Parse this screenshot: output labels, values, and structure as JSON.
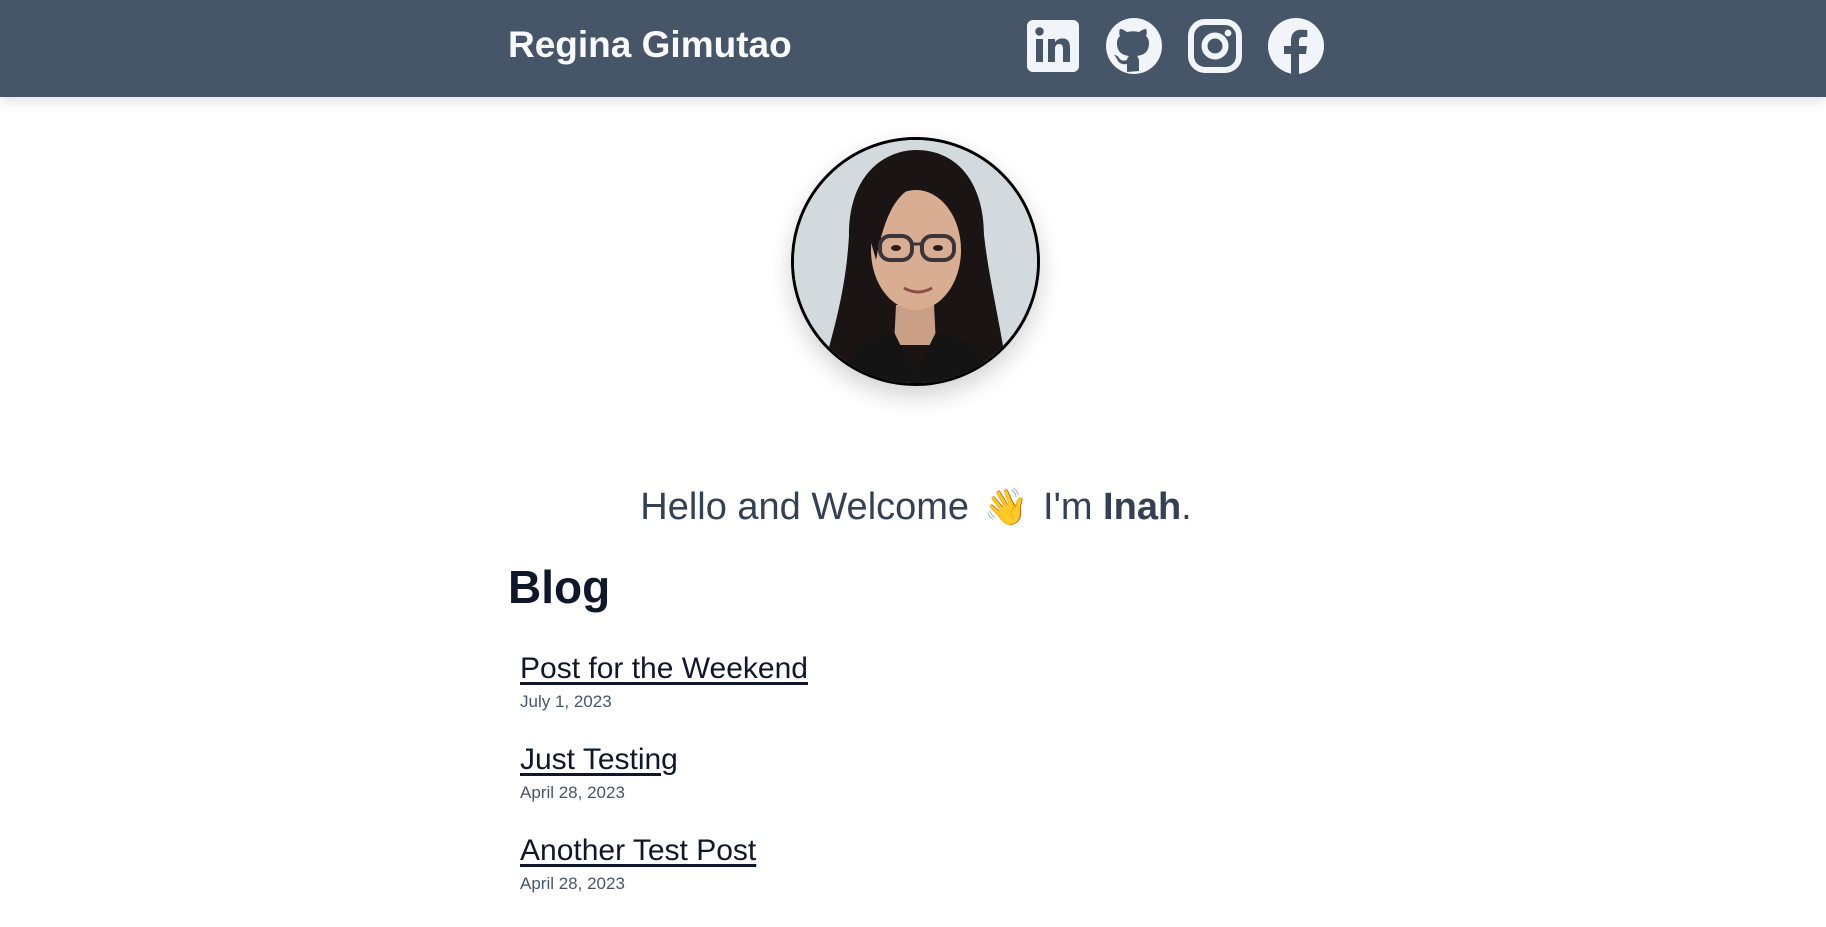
{
  "header": {
    "title": "Regina Gimutao",
    "background": "#475569",
    "socials": [
      {
        "icon": "linkedin-icon"
      },
      {
        "icon": "github-icon"
      },
      {
        "icon": "instagram-icon"
      },
      {
        "icon": "facebook-icon"
      }
    ]
  },
  "hero": {
    "greeting_prefix": "Hello and Welcome",
    "wave_emoji": "👋",
    "greeting_im": "I'm",
    "name": "Inah",
    "period": "."
  },
  "blog": {
    "heading": "Blog",
    "posts": [
      {
        "title": "Post for the Weekend",
        "date": "July 1, 2023"
      },
      {
        "title": "Just Testing",
        "date": "April 28, 2023"
      },
      {
        "title": "Another Test Post",
        "date": "April 28, 2023"
      }
    ]
  }
}
